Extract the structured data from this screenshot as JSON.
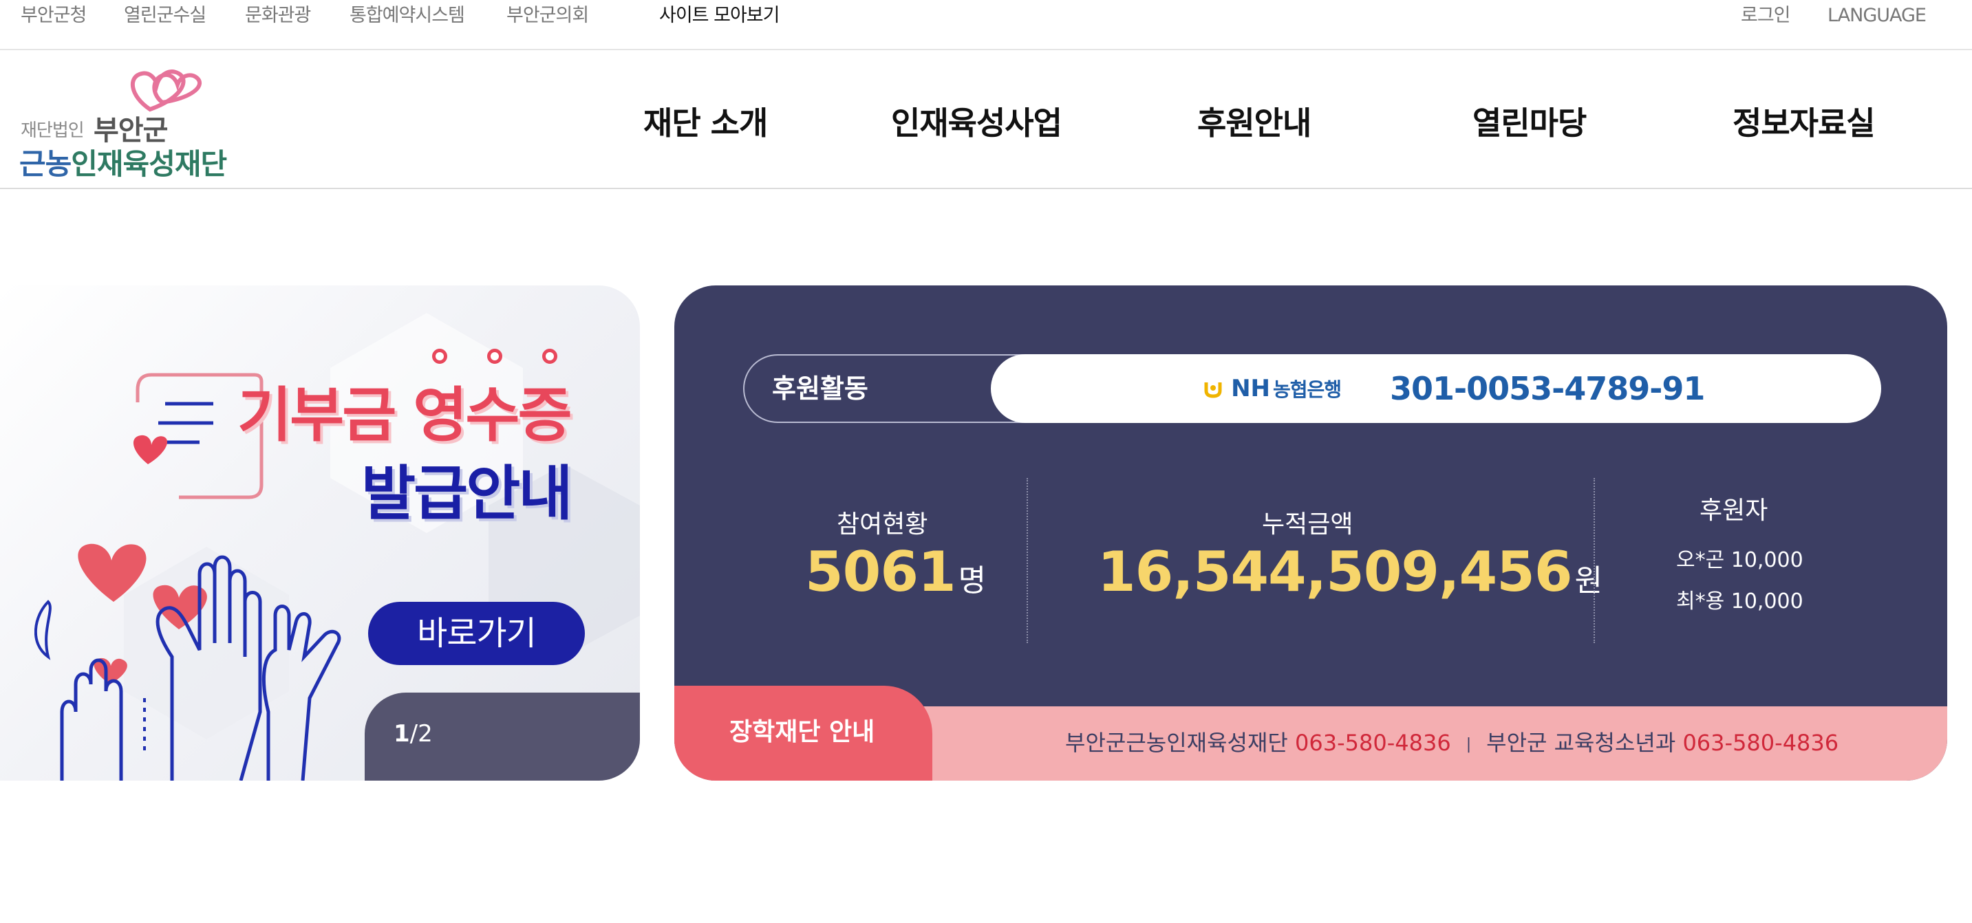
{
  "topbar": {
    "links": [
      "부안군청",
      "열린군수실",
      "문화관광",
      "통합예약시스템",
      "부안군의회"
    ],
    "sitemap": "사이트 모아보기",
    "login": "로그인",
    "language": "LANGUAGE"
  },
  "logo": {
    "small": "재단법인",
    "line1": "부안군",
    "line2_blue": "근농",
    "line2_green": "인재육성재단"
  },
  "gnb": [
    "재단 소개",
    "인재육성사업",
    "후원안내",
    "열린마당",
    "정보자료실"
  ],
  "banner": {
    "title1": "기부금 영수증",
    "title2": "발급안내",
    "button": "바로가기",
    "page_current": "1",
    "page_total": "/2"
  },
  "donation": {
    "activity_label": "후원활동",
    "bank_logo_text": "NH",
    "bank_name": "농협은행",
    "account": "301-0053-4789-91",
    "participants_label": "참여현황",
    "participants_value": "5061",
    "participants_unit": "명",
    "amount_label": "누적금액",
    "amount_value": "16,544,509,456",
    "amount_unit": "원",
    "donors_label": "후원자",
    "donors": [
      "오*곤 10,000",
      "최*용 10,000"
    ]
  },
  "info": {
    "tab": "장학재단 안내",
    "org1": "부안군근농인재육성재단 ",
    "tel1": "063-580-4836",
    "sep": "|",
    "org2": "부안군 교육청소년과 ",
    "tel2": "063-580-4836"
  },
  "colors": {
    "panel": "#3c3e63",
    "highlight": "#f7d56b",
    "accent_red": "#ec5f6b",
    "bank_blue": "#1f5ea8",
    "banner_btn": "#1c21a3"
  }
}
